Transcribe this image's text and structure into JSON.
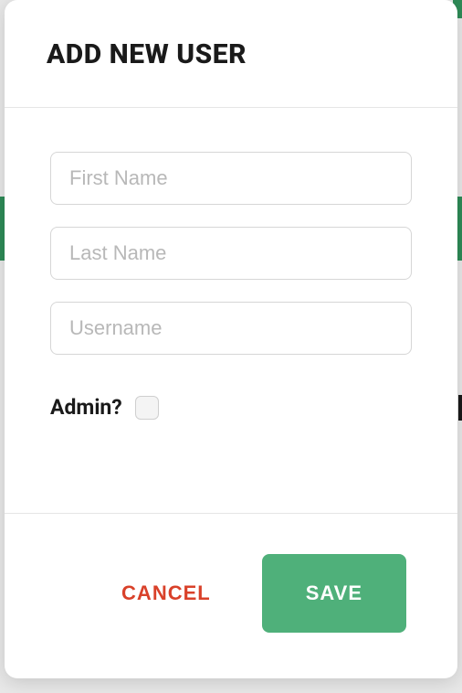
{
  "modal": {
    "title": "ADD NEW USER",
    "fields": {
      "first_name": {
        "placeholder": "First Name",
        "value": ""
      },
      "last_name": {
        "placeholder": "Last Name",
        "value": ""
      },
      "username": {
        "placeholder": "Username",
        "value": ""
      }
    },
    "admin_label": "Admin?",
    "admin_checked": false,
    "buttons": {
      "cancel": "CANCEL",
      "save": "SAVE"
    }
  }
}
